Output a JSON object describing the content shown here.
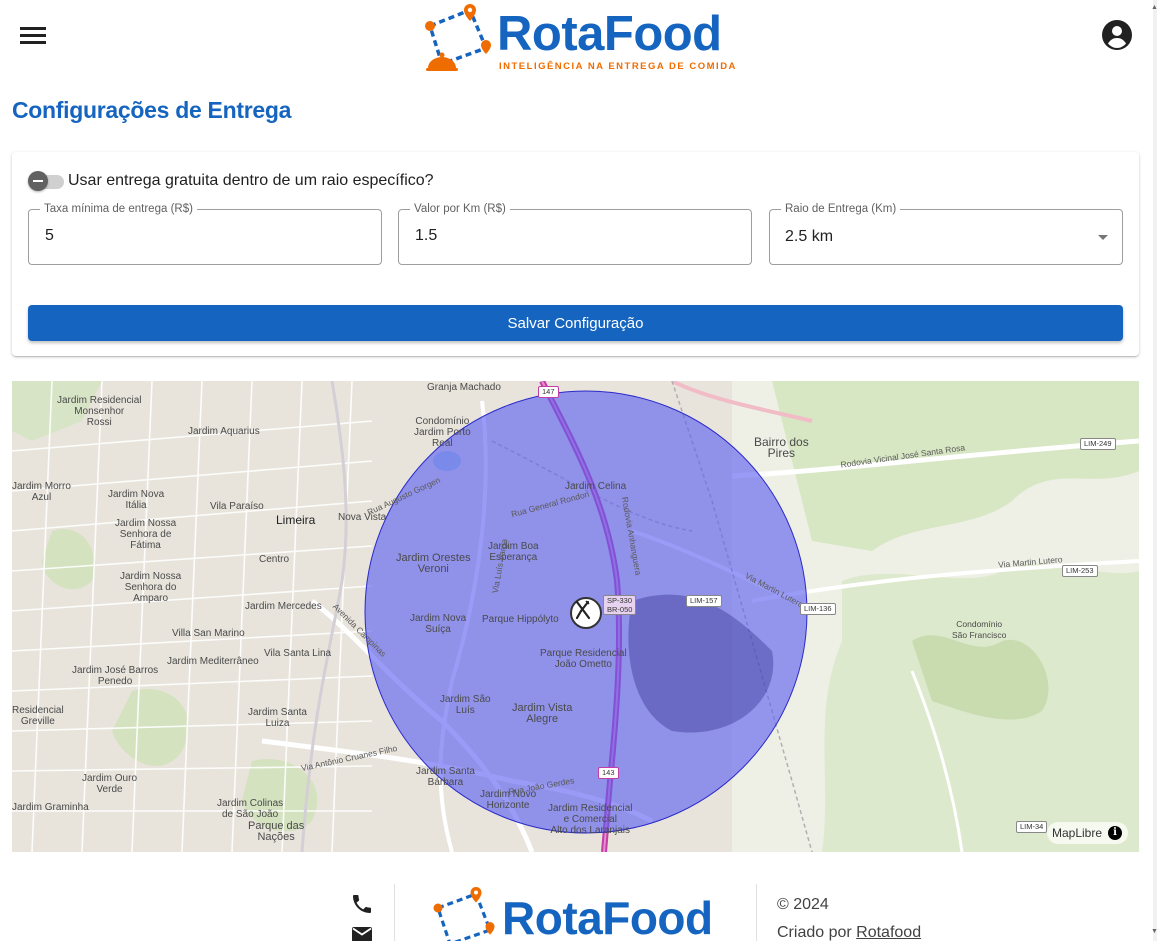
{
  "header": {
    "brand_name": "RotaFood",
    "brand_tagline": "INTELIGÊNCIA NA ENTREGA DE COMIDA",
    "menu_icon": "menu-icon",
    "account_icon": "account-circle-icon"
  },
  "page": {
    "title": "Configurações de Entrega"
  },
  "settings": {
    "free_delivery_toggle_label": "Usar entrega gratuita dentro de um raio específico?",
    "free_delivery_enabled": false,
    "min_fee": {
      "label": "Taxa mínima de entrega (R$)",
      "value": "5"
    },
    "per_km": {
      "label": "Valor por Km (R$)",
      "value": "1.5"
    },
    "radius": {
      "label": "Raio de Entrega (Km)",
      "value": "2.5 km"
    },
    "save_label": "Salvar Configuração"
  },
  "map": {
    "attribution": "MapLibre",
    "marker_icon": "restaurant-icon",
    "radius_fill_color": "#5a5ef0",
    "places": {
      "jardim_residencial_monsenhor_rossi": "Jardim Residencial\nMonsenhor\nRossi",
      "jardim_aquarius": "Jardim Aquarius",
      "condominio_porto_real": "Condomínio\nJardim Porto\nReal",
      "granja_machado": "Granja Machado",
      "bairro_dos_pires": "Bairro dos\nPires",
      "jardim_morro_azul": "Jardim Morro\nAzul",
      "jardim_nova_italia": "Jardim Nova\nItália",
      "vila_paraiso": "Vila Paraíso",
      "limeira": "Limeira",
      "nova_vista": "Nova Vista",
      "jardim_celina": "Jardim Celina",
      "jardim_nossa_senhora_fatima": "Jardim Nossa\nSenhora de\nFátima",
      "centro": "Centro",
      "jardim_orestes_veroni": "Jardim Orestes\nVeroni",
      "jardim_boa_esperanca": "Jardim Boa\nEsperança",
      "jardim_nossa_senhora_amparo": "Jardim Nossa\nSenhora do\nAmparo",
      "jardim_mercedes": "Jardim Mercedes",
      "jardim_nova_suica": "Jardim Nova\nSuíça",
      "parque_hippolyto": "Parque Hippólyto",
      "villa_san_marino": "Villa San Marino",
      "vila_santa_lina": "Vila Santa Lina",
      "parque_residencial_joao_ometto": "Parque Residencial\nJoão Ometto",
      "jardim_mediterraneo": "Jardim Mediterrâneo",
      "jardim_jose_barros_penedo": "Jardim José Barros\nPenedo",
      "jardim_sao_luis": "Jardim São\nLuís",
      "jardim_vista_alegre": "Jardim Vista\nAlegre",
      "residencial_greville": "Residencial\nGreville",
      "jardim_santa_luiza": "Jardim Santa\nLuiza",
      "jardim_ouro_verde": "Jardim Ouro\nVerde",
      "jardim_santa_barbara": "Jardim Santa\nBárbara",
      "jardim_novo_horizonte": "Jardim Novo\nHorizonte",
      "jardim_residencial_comercial_alto_laranjais": "Jardim Residencial\ne Comercial\nAlto dos Laranjais",
      "jardim_graminha": "Jardim Graminha",
      "jardim_colinas_sao_joao": "Jardim Colinas\nde São João",
      "parque_das_nacoes": "Parque das\nNações",
      "condominio_sao_francisco": "Condomínio\nSão Francisco"
    },
    "roads": {
      "rodovia_vicinal_santa_rosa": "Rodovia Vicinal José Santa Rosa",
      "via_martin_lutero": "Via Martin Lutero",
      "via_antonio_cruanes_filho": "Via Antônio Cruanes Filho",
      "rua_general_rondon": "Rua General Rondon",
      "rodovia_anhanguera": "Rodovia Anhanguera",
      "via_luis_varga": "Via Luís Varga",
      "rua_joao_gerdes": "Rua João Gerdes",
      "avenida_campinas": "Avenida Campinas",
      "rua_augusto_gorgen": "Rua Augusto Gorgen"
    },
    "shields": {
      "lim_249": "LIM-249",
      "lim_253": "LIM-253",
      "lim_136": "LIM-136",
      "lim_157": "LIM-157",
      "sp_330": "SP-330",
      "br_050": "BR-050",
      "lim_34x": "LIM-34",
      "km_143": "143",
      "km_147": "147"
    }
  },
  "footer": {
    "phone_icon": "phone-icon",
    "email_icon": "email-icon",
    "brand_name": "RotaFood",
    "copyright": "© 2024",
    "credit_prefix": "Criado por ",
    "credit_link": "Rotafood"
  }
}
